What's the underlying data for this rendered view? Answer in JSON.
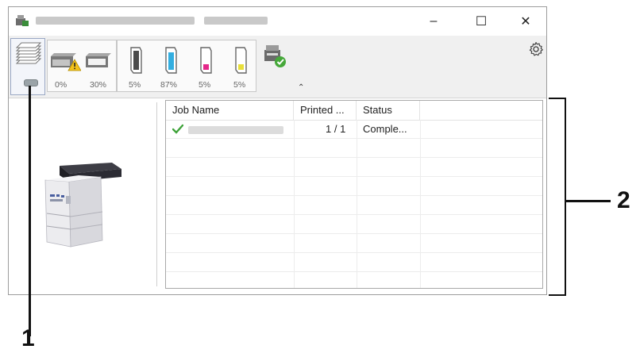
{
  "window": {
    "controls": {
      "minimize": "–",
      "maximize": "☐",
      "close": "✕"
    }
  },
  "toolbar": {
    "tray_levels": [
      "0%",
      "30%"
    ],
    "toner_levels": [
      "5%",
      "87%",
      "5%",
      "5%"
    ],
    "toner_colors": [
      "#3a3a3a",
      "#33aee0",
      "#e4288a",
      "#e8df3a"
    ],
    "expand_glyph": "⌃",
    "gear_icon": "gear-icon"
  },
  "job_list": {
    "columns": [
      "Job Name",
      "Printed ...",
      "Status"
    ],
    "rows": [
      {
        "printed": "1 / 1",
        "status": "Comple..."
      }
    ]
  },
  "callouts": {
    "one": "1",
    "two": "2"
  }
}
